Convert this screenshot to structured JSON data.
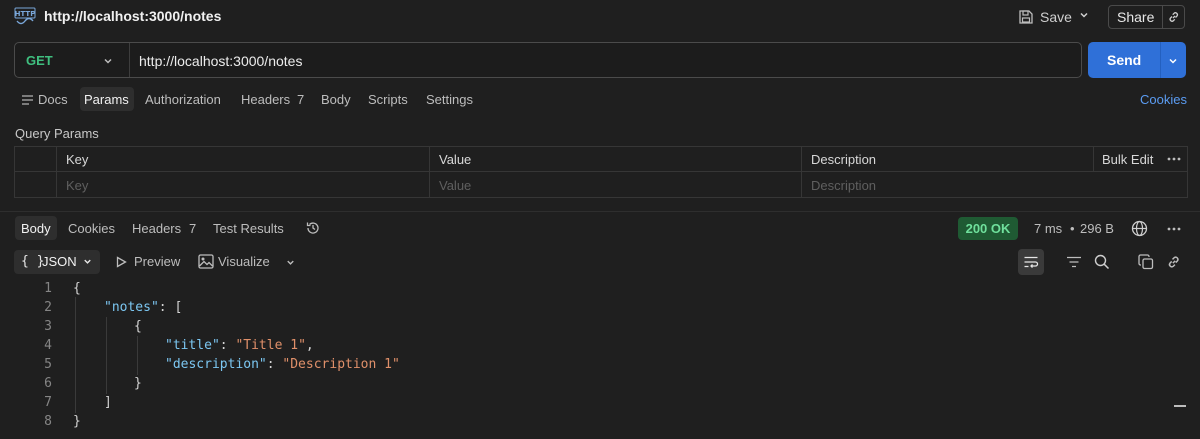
{
  "header": {
    "tab_title": "http://localhost:3000/notes",
    "save_label": "Save",
    "share_label": "Share"
  },
  "request": {
    "method": "GET",
    "url": "http://localhost:3000/notes",
    "send_label": "Send",
    "method_color": "#3fbf7f"
  },
  "request_tabs": {
    "docs": "Docs",
    "params": "Params",
    "authorization": "Authorization",
    "headers": "Headers",
    "headers_count": "7",
    "body": "Body",
    "scripts": "Scripts",
    "settings": "Settings",
    "cookies": "Cookies"
  },
  "query_params": {
    "title": "Query Params",
    "columns": {
      "key": "Key",
      "value": "Value",
      "description": "Description"
    },
    "bulk_edit": "Bulk Edit",
    "placeholders": {
      "key": "Key",
      "value": "Value",
      "description": "Description"
    }
  },
  "response_tabs": {
    "body": "Body",
    "cookies": "Cookies",
    "headers": "Headers",
    "headers_count": "7",
    "test_results": "Test Results"
  },
  "response_meta": {
    "status": "200 OK",
    "time": "7 ms",
    "size": "296 B",
    "status_color": "#6fe09c"
  },
  "view_modes": {
    "json": "JSON",
    "json_braces": "{ }",
    "preview": "Preview",
    "visualize": "Visualize"
  },
  "code": {
    "line_numbers": [
      "1",
      "2",
      "3",
      "4",
      "5",
      "6",
      "7",
      "8"
    ],
    "lines": {
      "l1": "{",
      "l2_key": "\"notes\"",
      "l2_rest": ": [",
      "l3": "{",
      "l4_key": "\"title\"",
      "l4_sep": ": ",
      "l4_val": "\"Title 1\"",
      "l4_end": ",",
      "l5_key": "\"description\"",
      "l5_sep": ": ",
      "l5_val": "\"Description 1\"",
      "l6": "}",
      "l7": "]",
      "l8": "}"
    }
  },
  "icons": [
    "http-icon",
    "save-icon",
    "chevron-down-icon",
    "link-icon",
    "docs-icon",
    "history-icon",
    "globe-icon",
    "more-icon",
    "play-icon",
    "image-icon",
    "wrap-icon",
    "filter-icon",
    "search-icon",
    "copy-icon"
  ]
}
